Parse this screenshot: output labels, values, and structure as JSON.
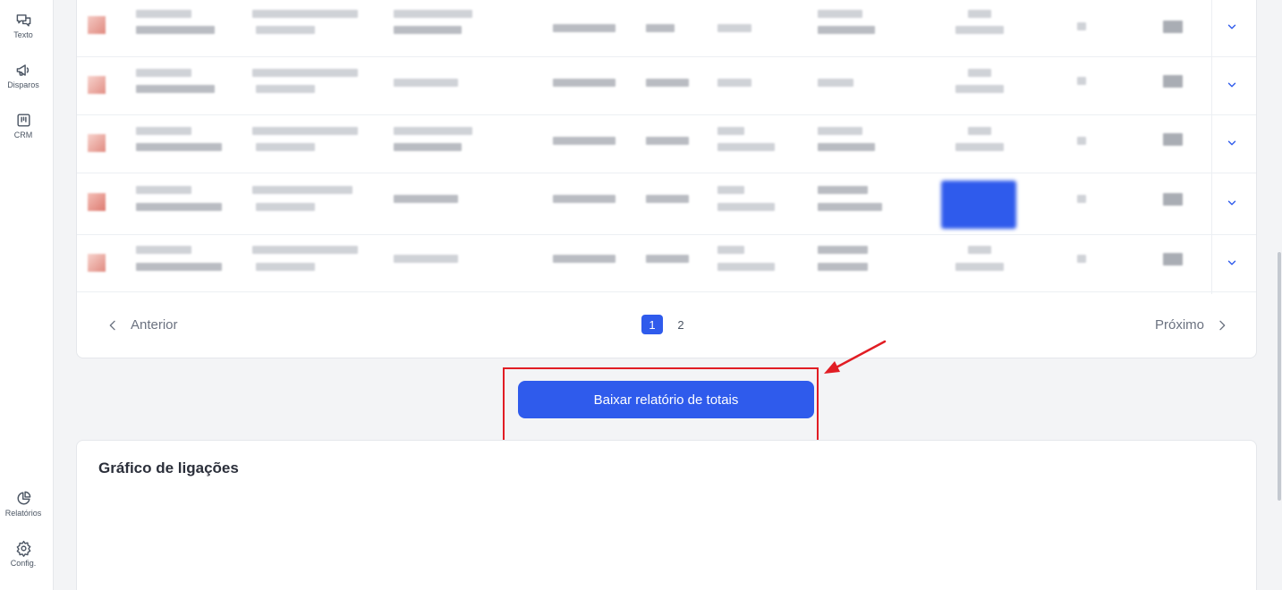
{
  "sidebar": {
    "items": [
      {
        "label": "Texto",
        "icon": "chat-icon"
      },
      {
        "label": "Disparos",
        "icon": "megaphone-icon"
      },
      {
        "label": "CRM",
        "icon": "kanban-icon"
      },
      {
        "label": "Relatórios",
        "icon": "pie-chart-icon"
      },
      {
        "label": "Config.",
        "icon": "gear-icon"
      }
    ]
  },
  "table": {
    "rows_count": 5,
    "note": "cell contents are pixelated/redacted in the screenshot"
  },
  "pagination": {
    "prev_label": "Anterior",
    "next_label": "Próximo",
    "pages": [
      "1",
      "2"
    ],
    "current_page": "1"
  },
  "download_button": {
    "label": "Baixar relatório de totais"
  },
  "chart_card": {
    "title": "Gráfico de ligações"
  },
  "colors": {
    "accent": "#2f5bec",
    "annotation": "#e11d24"
  }
}
